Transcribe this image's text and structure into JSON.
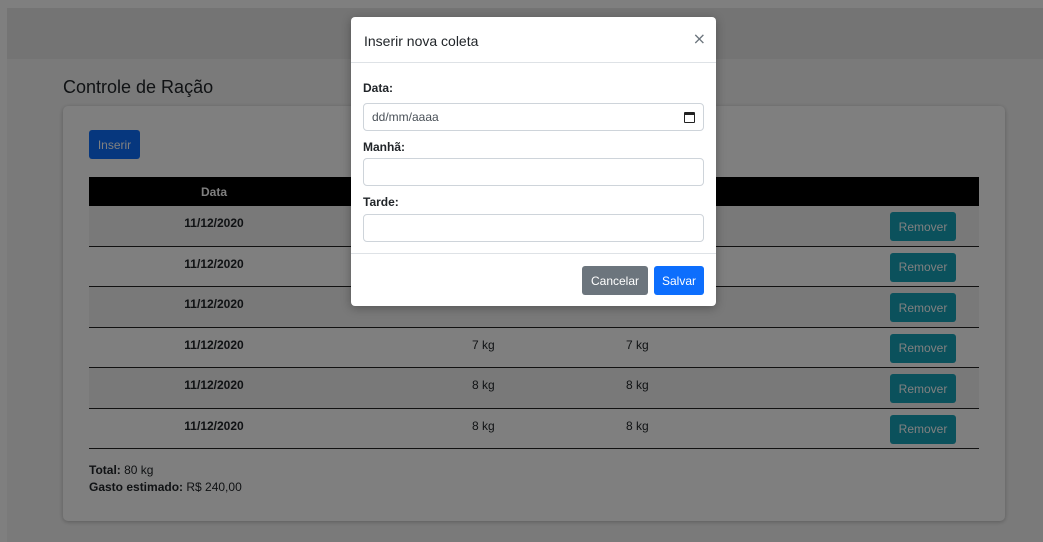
{
  "page": {
    "title": "Controle de Ração",
    "insert_label": "Inserir",
    "table": {
      "header_date": "Data",
      "rows": [
        {
          "date": "11/12/2020",
          "morning": "",
          "afternoon": "",
          "remove": "Remover"
        },
        {
          "date": "11/12/2020",
          "morning": "",
          "afternoon": "",
          "remove": "Remover"
        },
        {
          "date": "11/12/2020",
          "morning": "",
          "afternoon": "",
          "remove": "Remover"
        },
        {
          "date": "11/12/2020",
          "morning": "7 kg",
          "afternoon": "7 kg",
          "remove": "Remover"
        },
        {
          "date": "11/12/2020",
          "morning": "8 kg",
          "afternoon": "8 kg",
          "remove": "Remover"
        },
        {
          "date": "11/12/2020",
          "morning": "8 kg",
          "afternoon": "8 kg",
          "remove": "Remover"
        }
      ]
    },
    "totals": {
      "total_label": "Total:",
      "total_value": " 80 kg",
      "cost_label": "Gasto estimado:",
      "cost_value": " R$ 240,00"
    }
  },
  "modal": {
    "title": "Inserir nova coleta",
    "close_symbol": "×",
    "date_label": "Data:",
    "date_placeholder": "dd/mm/aaaa",
    "morning_label": "Manhã:",
    "afternoon_label": "Tarde:",
    "cancel_label": "Cancelar",
    "save_label": "Salvar"
  },
  "icons": {
    "calendar": "calendar-icon",
    "close": "close-icon"
  },
  "colors": {
    "primary": "#0d6efd",
    "info": "#17a2b8",
    "secondary": "#6c757d",
    "table_header": "#000000"
  }
}
